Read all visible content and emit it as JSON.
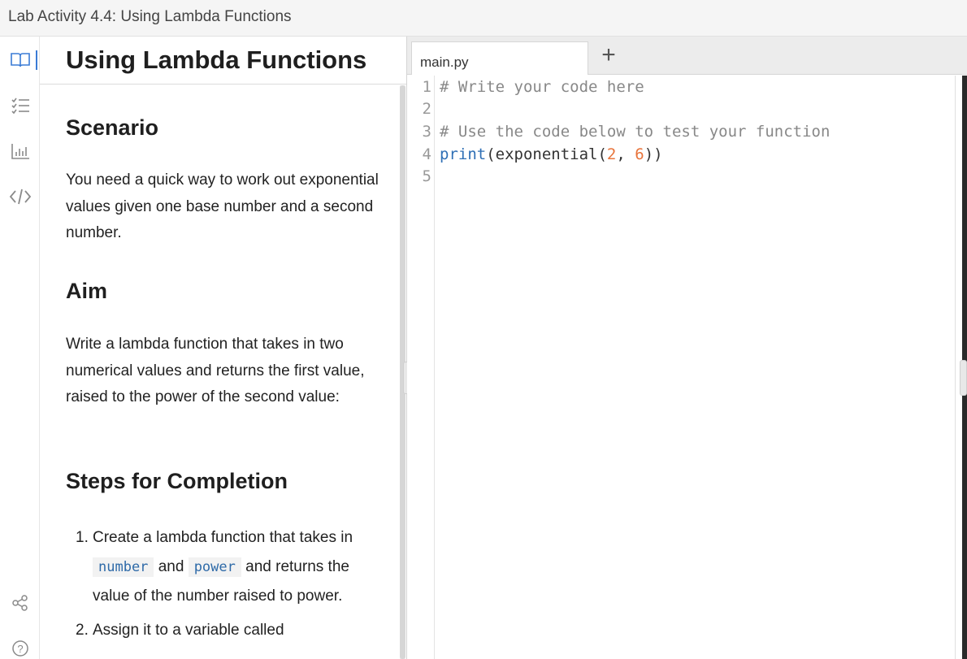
{
  "window": {
    "title": "Lab Activity 4.4: Using Lambda Functions"
  },
  "sidebar": {
    "icons": [
      {
        "name": "book-icon",
        "active": true
      },
      {
        "name": "list-icon",
        "active": false
      },
      {
        "name": "chart-icon",
        "active": false
      },
      {
        "name": "code-icon",
        "active": false
      },
      {
        "name": "share-icon",
        "active": false
      },
      {
        "name": "help-icon",
        "active": false
      }
    ]
  },
  "lesson": {
    "title": "Using Lambda Functions",
    "scenario_heading": "Scenario",
    "scenario_text": "You need a quick way to work out exponential values given one base number and a second number.",
    "aim_heading": "Aim",
    "aim_text": "Write a lambda function that takes in two numerical values and returns the first value, raised to the power of the second value:",
    "steps_heading": "Steps for Completion",
    "steps": [
      {
        "number": "1.",
        "text_before": "Create a lambda function that takes in ",
        "code1": "number",
        "text_mid": " and ",
        "code2": "power",
        "text_after": " and returns the value of the number raised to power."
      },
      {
        "number": "2.",
        "text": "Assign it to a variable called"
      }
    ]
  },
  "editor": {
    "tab_label": "main.py",
    "add_tab_label": "+",
    "lines": [
      {
        "num": "1",
        "text": "# Write your code here"
      },
      {
        "num": "2",
        "text": ""
      },
      {
        "num": "3",
        "text": "# Use the code below to test your function"
      },
      {
        "num": "4",
        "keyword": "print",
        "p1": "(exponential(",
        "n1": "2",
        "sep": ", ",
        "n2": "6",
        "p2": "))"
      },
      {
        "num": "5",
        "text": ""
      }
    ]
  },
  "colors": {
    "accent": "#3a7bd5",
    "comment": "#888888",
    "keyword": "#2f6fb5",
    "number": "#e8743b",
    "inline_code": "#2e6aa8"
  }
}
